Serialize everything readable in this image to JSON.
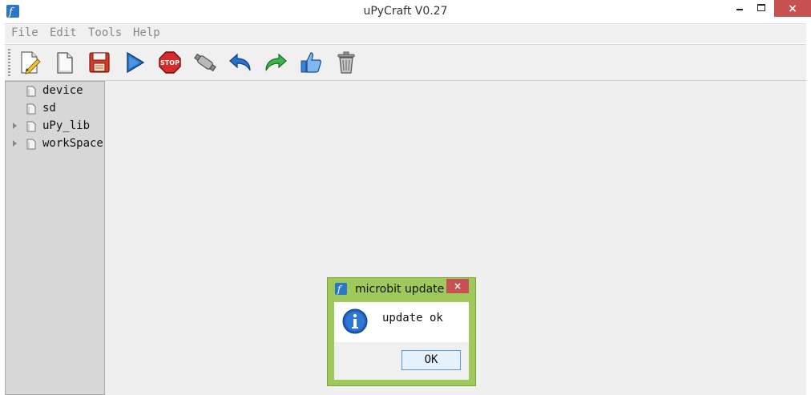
{
  "window": {
    "title": "uPyCraft V0.27",
    "close_glyph": "×"
  },
  "menu": [
    "File",
    "Edit",
    "Tools",
    "Help"
  ],
  "toolbar": [
    {
      "icon": "new-file-icon"
    },
    {
      "icon": "open-file-icon"
    },
    {
      "icon": "save-icon"
    },
    {
      "icon": "run-icon"
    },
    {
      "icon": "stop-icon"
    },
    {
      "icon": "connect-icon"
    },
    {
      "icon": "undo-icon"
    },
    {
      "icon": "redo-icon"
    },
    {
      "icon": "syntax-check-icon"
    },
    {
      "icon": "clear-icon"
    }
  ],
  "tree": [
    {
      "label": "device",
      "expandable": false
    },
    {
      "label": "sd",
      "expandable": false
    },
    {
      "label": "uPy_lib",
      "expandable": true
    },
    {
      "label": "workSpace",
      "expandable": true
    }
  ],
  "dialog": {
    "title": "microbit update",
    "message": "update ok",
    "ok_label": "OK",
    "close_glyph": "×"
  },
  "colors": {
    "dialog_border": "#9fc95b",
    "close_button": "#c75050",
    "ok_button_border": "#5a9bd5",
    "tree_background": "#d7d7d7",
    "editor_background": "#efefef"
  }
}
